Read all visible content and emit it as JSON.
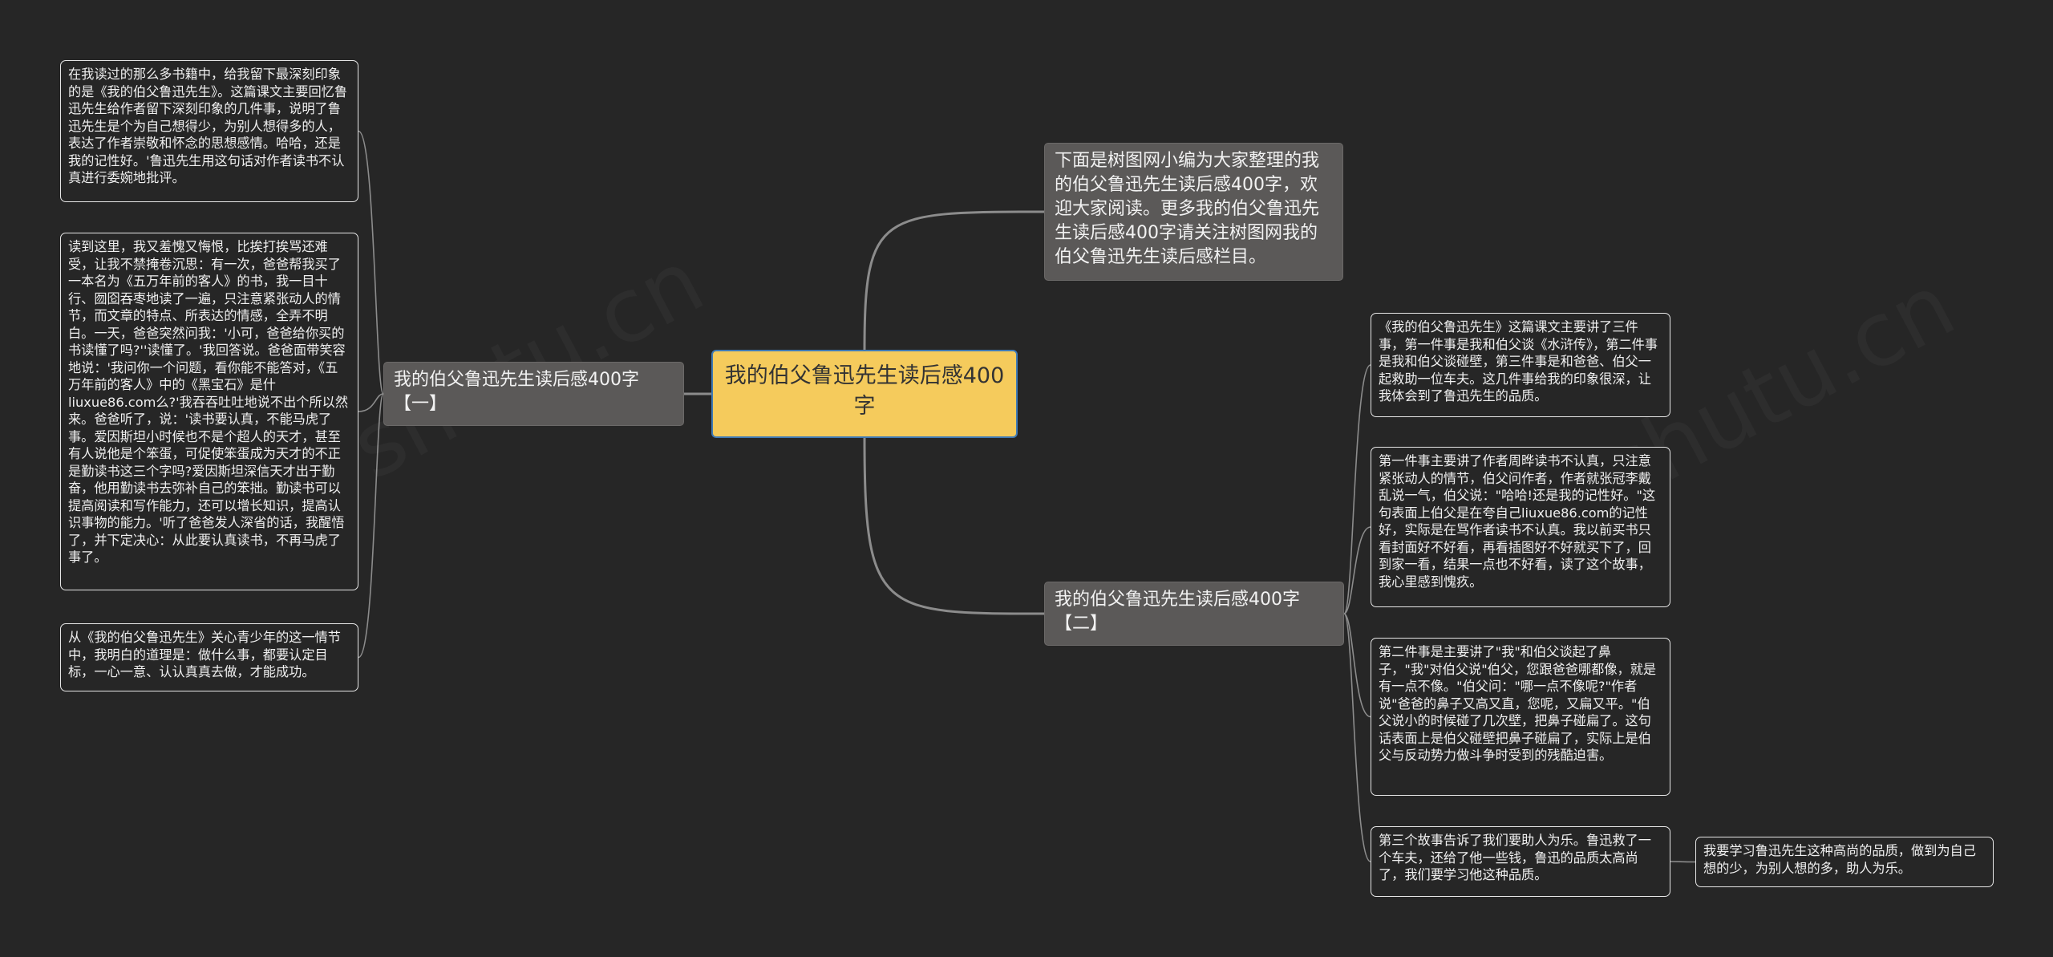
{
  "root": {
    "text": "我的伯父鲁迅先生读后感400字"
  },
  "branches": {
    "intro": {
      "text": "下面是树图网小编为大家整理的我的伯父鲁迅先生读后感400字，欢迎大家阅读。更多我的伯父鲁迅先生读后感400字请关注树图网我的伯父鲁迅先生读后感栏目。"
    },
    "left": {
      "text": "我的伯父鲁迅先生读后感400字【一】"
    },
    "right": {
      "text": "我的伯父鲁迅先生读后感400字【二】"
    }
  },
  "left_leaves": [
    {
      "text": "在我读过的那么多书籍中，给我留下最深刻印象的是《我的伯父鲁迅先生》。这篇课文主要回忆鲁迅先生给作者留下深刻印象的几件事，说明了鲁迅先生是个为自己想得少，为别人想得多的人，表达了作者崇敬和怀念的思想感情。哈哈，还是我的记性好。'鲁迅先生用这句话对作者读书不认真进行委婉地批评。"
    },
    {
      "text": "读到这里，我又羞愧又悔恨，比挨打挨骂还难受，让我不禁掩卷沉思：有一次，爸爸帮我买了一本名为《五万年前的客人》的书，我一目十行、囫囵吞枣地读了一遍，只注意紧张动人的情节，而文章的特点、所表达的情感，全弄不明白。一天，爸爸突然问我：'小可，爸爸给你买的书读懂了吗?''读懂了。'我回答说。爸爸面带笑容地说：'我问你一个问题，看你能不能答对，《五万年前的客人》中的《黑宝石》是什liuxue86.com么?'我吞吞吐吐地说不出个所以然来。爸爸听了，说：'读书要认真，不能马虎了事。爱因斯坦小时候也不是个超人的天才，甚至有人说他是个笨蛋，可促使笨蛋成为天才的不正是勤读书这三个字吗?爱因斯坦深信天才出于勤奋，他用勤读书去弥补自己的笨拙。勤读书可以提高阅读和写作能力，还可以增长知识，提高认识事物的能力。'听了爸爸发人深省的话，我醒悟了，并下定决心：从此要认真读书，不再马虎了事了。"
    },
    {
      "text": "从《我的伯父鲁迅先生》关心青少年的这一情节中，我明白的道理是：做什么事，都要认定目标，一心一意、认认真真去做，才能成功。"
    }
  ],
  "right_leaves": [
    {
      "text": "《我的伯父鲁迅先生》这篇课文主要讲了三件事，第一件事是我和伯父谈《水浒传》，第二件事是我和伯父谈碰壁，第三件事是和爸爸、伯父一起救助一位车夫。这几件事给我的印象很深，让我体会到了鲁迅先生的品质。"
    },
    {
      "text": "第一件事主要讲了作者周晔读书不认真，只注意紧张动人的情节，伯父问作者，作者就张冠李戴乱说一气，伯父说：\"哈哈!还是我的记性好。\"这句表面上伯父是在夸自己liuxue86.com的记性好，实际是在骂作者读书不认真。我以前买书只看封面好不好看，再看插图好不好就买下了，回到家一看，结果一点也不好看，读了这个故事，我心里感到愧疚。"
    },
    {
      "text": "第二件事是主要讲了\"我\"和伯父谈起了鼻子，\"我\"对伯父说\"伯父，您跟爸爸哪都像，就是有一点不像。\"伯父问：\"哪一点不像呢?\"作者说\"爸爸的鼻子又高又直，您呢，又扁又平。\"伯父说小的时候碰了几次壁，把鼻子碰扁了。这句话表面上是伯父碰壁把鼻子碰扁了，实际上是伯父与反动势力做斗争时受到的残酷迫害。"
    },
    {
      "text": "第三个故事告诉了我们要助人为乐。鲁迅救了一个车夫，还给了他一些钱，鲁迅的品质太高尚了，我们要学习他这种品质。"
    },
    {
      "text": "我要学习鲁迅先生这种高尚的品质，做到为自己想的少，为别人想的多，助人为乐。"
    }
  ],
  "watermarks": [
    "shutu.cn",
    "shutu.cn"
  ],
  "colors": {
    "background": "#262626",
    "root_fill": "#f5cb5c",
    "branch_fill": "#5b5958",
    "link": "#8c8c8c"
  }
}
